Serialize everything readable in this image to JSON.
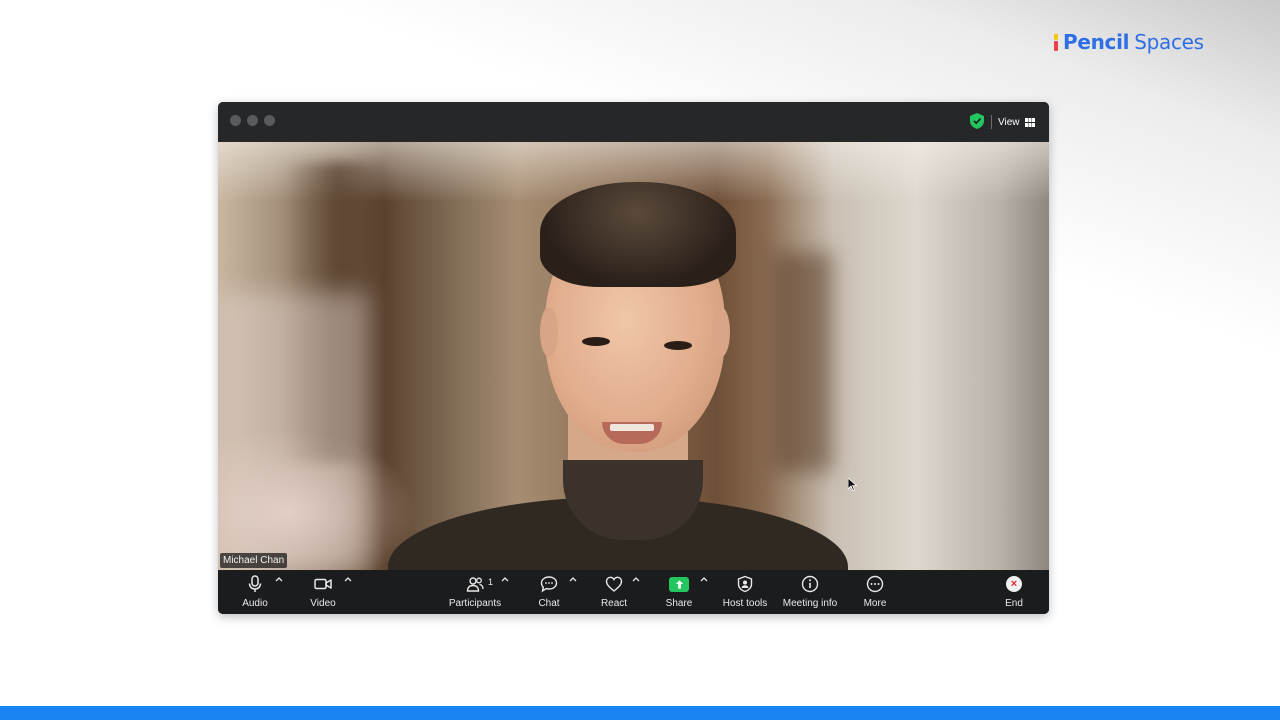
{
  "brand": {
    "part1": "Pencil",
    "part2": "Spaces"
  },
  "window": {
    "view_label": "View",
    "participant_name": "Michael Chan",
    "participants_count": "1"
  },
  "toolbar": {
    "audio": "Audio",
    "video": "Video",
    "participants": "Participants",
    "chat": "Chat",
    "react": "React",
    "share": "Share",
    "host_tools": "Host tools",
    "meeting_info": "Meeting info",
    "more": "More",
    "end": "End"
  },
  "colors": {
    "brand_blue": "#2f6fe6",
    "share_green": "#23c55e",
    "end_red": "#e0242e",
    "bottom_bar": "#1a84f2"
  }
}
